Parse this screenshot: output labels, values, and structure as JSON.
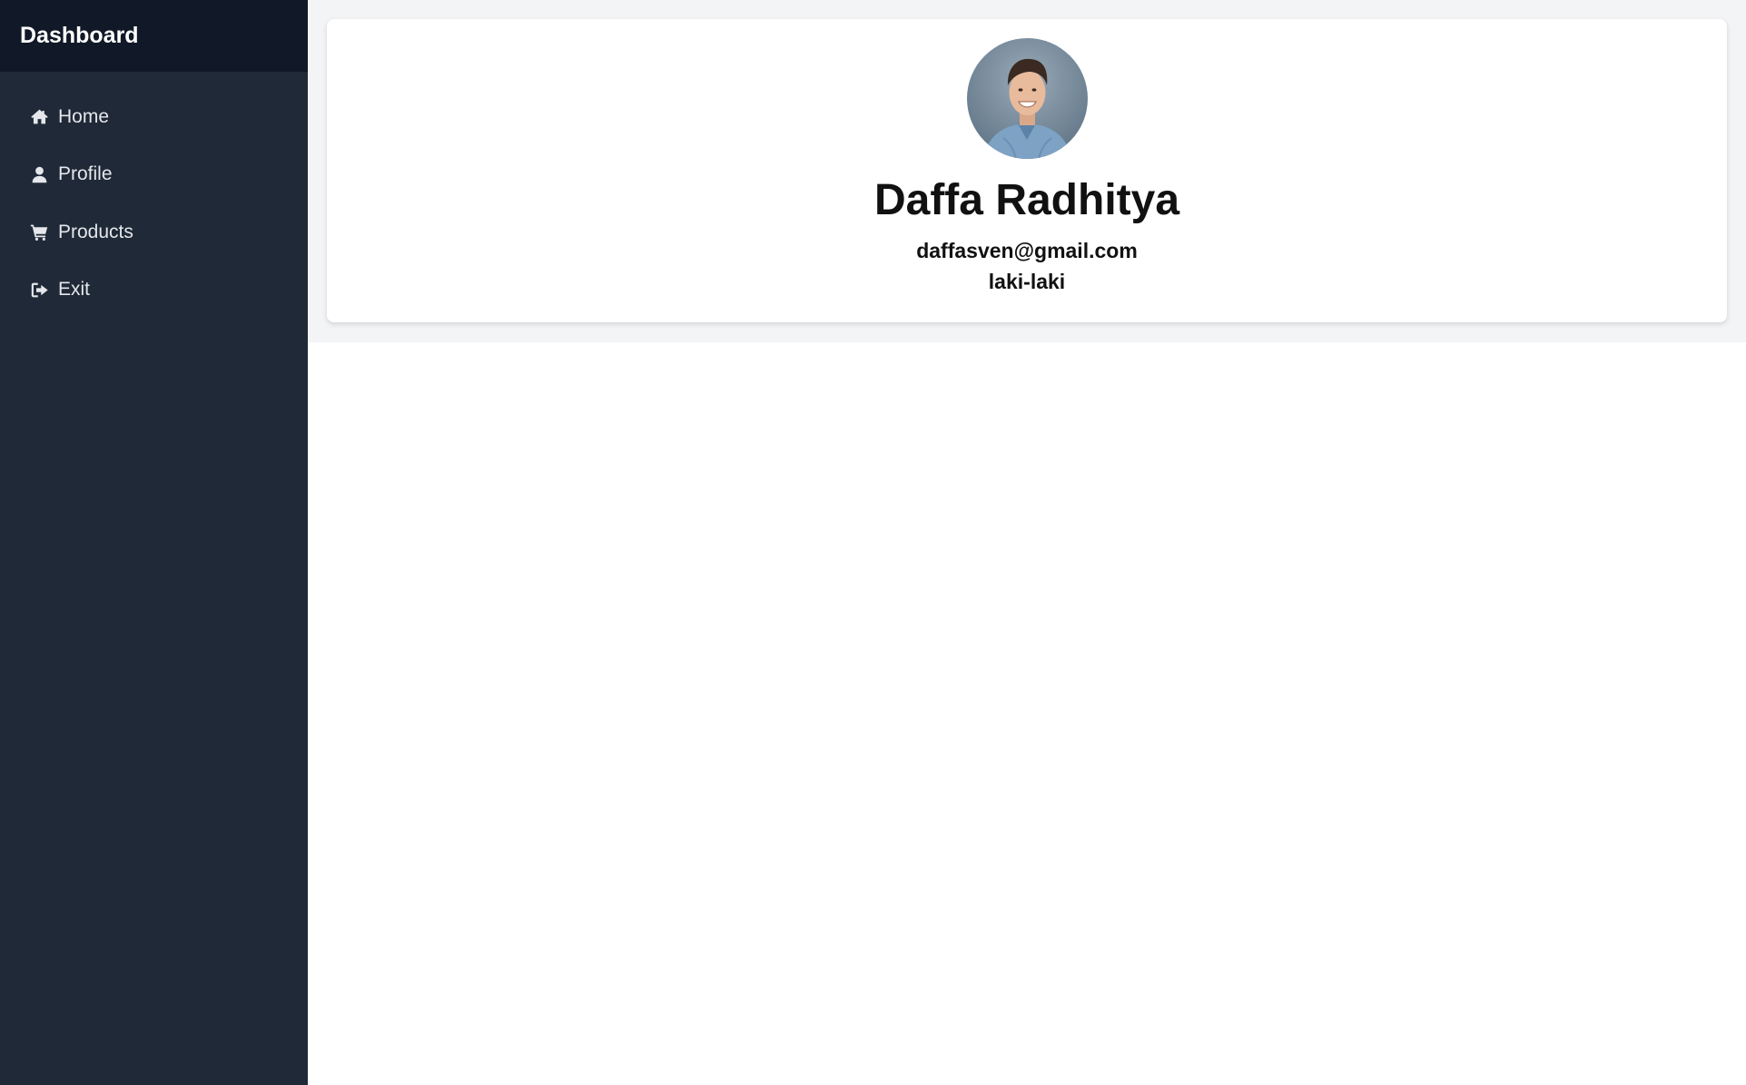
{
  "sidebar": {
    "title": "Dashboard",
    "items": [
      {
        "label": "Home",
        "icon": "home-icon"
      },
      {
        "label": "Profile",
        "icon": "user-icon"
      },
      {
        "label": "Products",
        "icon": "cart-icon"
      },
      {
        "label": "Exit",
        "icon": "sign-out-icon"
      }
    ]
  },
  "profile": {
    "name": "Daffa Radhitya",
    "email": "daffasven@gmail.com",
    "gender": "laki-laki",
    "avatar": "avatar-photo"
  },
  "colors": {
    "sidebar_bg": "#1f2937",
    "sidebar_header_bg": "#111827",
    "main_band_bg": "#f3f4f6",
    "card_bg": "#ffffff"
  }
}
